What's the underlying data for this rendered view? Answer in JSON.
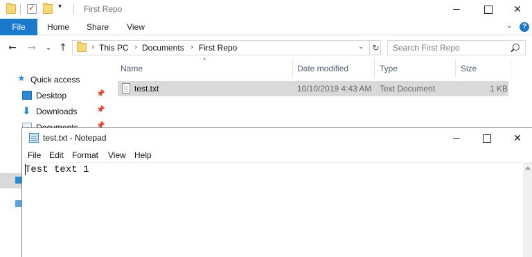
{
  "explorer": {
    "title": "First Repo",
    "quick_access_dropdown": "▾",
    "caption": {
      "minimize": "",
      "maximize": "",
      "close": "✕"
    },
    "ribbon": {
      "tabs": [
        "File",
        "Home",
        "Share",
        "View"
      ],
      "expand": "⌄",
      "help": "?"
    },
    "nav": {
      "back": "←",
      "forward": "→",
      "recent": "⌄",
      "up": "↑",
      "breadcrumbs": [
        "This PC",
        "Documents",
        "First Repo"
      ],
      "crumb_separator": "›",
      "address_dropdown": "⌄",
      "refresh": "↻",
      "search_placeholder": "Search First Repo"
    },
    "sidebar": {
      "items": [
        {
          "label": "Quick access",
          "icon": "star-icon"
        },
        {
          "label": "Desktop",
          "icon": "desktop-icon",
          "pinned": true
        },
        {
          "label": "Downloads",
          "icon": "download-icon",
          "pinned": true
        },
        {
          "label": "Documents",
          "icon": "documents-icon",
          "pinned": true
        }
      ],
      "pin_glyph": "📌"
    },
    "file_list": {
      "columns": [
        "Name",
        "Date modified",
        "Type",
        "Size"
      ],
      "sort_indicator": "⌃",
      "rows": [
        {
          "name": "test.txt",
          "date_modified": "10/10/2019 4:43 AM",
          "type": "Text Document",
          "size": "1 KB"
        }
      ]
    }
  },
  "notepad": {
    "title": "test.txt - Notepad",
    "caption": {
      "minimize": "",
      "maximize": "",
      "close": "✕"
    },
    "menu": [
      "File",
      "Edit",
      "Format",
      "View",
      "Help"
    ],
    "content": "Test text 1"
  },
  "colors": {
    "ribbon_file_tab": "#1979ca",
    "selection": "#d9d9d9",
    "accent_blue": "#2b8ad6",
    "column_header": "#4c607a"
  }
}
